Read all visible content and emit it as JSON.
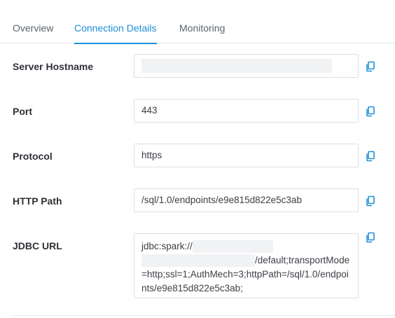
{
  "tabs": [
    {
      "label": "Overview",
      "active": false
    },
    {
      "label": "Connection Details",
      "active": true
    },
    {
      "label": "Monitoring",
      "active": false
    }
  ],
  "fields": {
    "server_hostname": {
      "label": "Server Hostname",
      "value": ""
    },
    "port": {
      "label": "Port",
      "value": "443"
    },
    "protocol": {
      "label": "Protocol",
      "value": "https"
    },
    "http_path": {
      "label": "HTTP Path",
      "value": "/sql/1.0/endpoints/e9e815d822e5c3ab"
    },
    "jdbc_url": {
      "label": "JDBC URL",
      "value_prefix": "jdbc:spark://",
      "value_suffix": "/default;transportMode=http;ssl=1;AuthMech=3;httpPath=/sql/1.0/endpoints/e9e815d822e5c3ab;"
    }
  },
  "icons": {
    "copy": "copy-icon"
  },
  "colors": {
    "accent": "#1d8fd8",
    "copy_icon": "#1d8fd8"
  }
}
